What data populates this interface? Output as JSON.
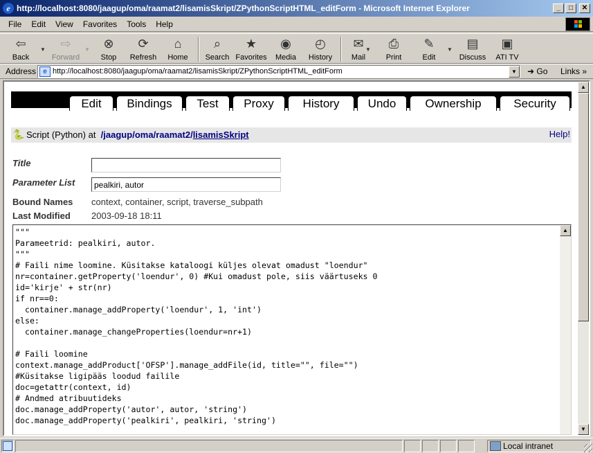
{
  "window": {
    "title": "http://localhost:8080/jaagup/oma/raamat2/lisamisSkript/ZPythonScriptHTML_editForm - Microsoft Internet Explorer",
    "app_icon": "ie-icon",
    "minimize": "_",
    "maximize": "□",
    "close": "✕"
  },
  "menu": [
    "File",
    "Edit",
    "View",
    "Favorites",
    "Tools",
    "Help"
  ],
  "toolbar": {
    "back": "Back",
    "forward": "Forward",
    "stop": "Stop",
    "refresh": "Refresh",
    "home": "Home",
    "search": "Search",
    "favorites": "Favorites",
    "media": "Media",
    "history": "History",
    "mail": "Mail",
    "print": "Print",
    "edit": "Edit",
    "discuss": "Discuss",
    "ati": "ATI TV"
  },
  "address": {
    "label": "Address",
    "url": "http://localhost:8080/jaagup/oma/raamat2/lisamisSkript/ZPythonScriptHTML_editForm",
    "go": "Go",
    "links": "Links"
  },
  "zope": {
    "tabs": [
      "Edit",
      "Bindings",
      "Test",
      "Proxy",
      "History",
      "Undo",
      "Ownership",
      "Security"
    ],
    "active_tab": "Edit",
    "header": {
      "type_text": "Script (Python) at",
      "path_sep": "/",
      "path": [
        "jaagup",
        "oma",
        "raamat2"
      ],
      "current": "lisamisSkript",
      "help": "Help!"
    },
    "form": {
      "title_label": "Title",
      "title_value": "",
      "params_label": "Parameter List",
      "params_value": "pealkiri, autor",
      "bound_label": "Bound Names",
      "bound_value": "context, container, script, traverse_subpath",
      "modified_label": "Last Modified",
      "modified_value": "2003-09-18 18:11"
    },
    "code": "\"\"\"\nParameetrid: pealkiri, autor.\n\"\"\"\n# Faili nime loomine. Küsitakse kataloogi küljes olevat omadust \"loendur\"\nnr=container.getProperty('loendur', 0) #Kui omadust pole, siis väärtuseks 0\nid='kirje' + str(nr)\nif nr==0:\n  container.manage_addProperty('loendur', 1, 'int')\nelse:\n  container.manage_changeProperties(loendur=nr+1)\n\n# Faili loomine\ncontext.manage_addProduct['OFSP'].manage_addFile(id, title=\"\", file=\"\")\n#Küsitakse ligipääs loodud failile\ndoc=getattr(context, id)\n# Andmed atribuutideks\ndoc.manage_addProperty('autor', autor, 'string')\ndoc.manage_addProperty('pealkiri', pealkiri, 'string')"
  },
  "status": {
    "zone": "Local intranet"
  }
}
